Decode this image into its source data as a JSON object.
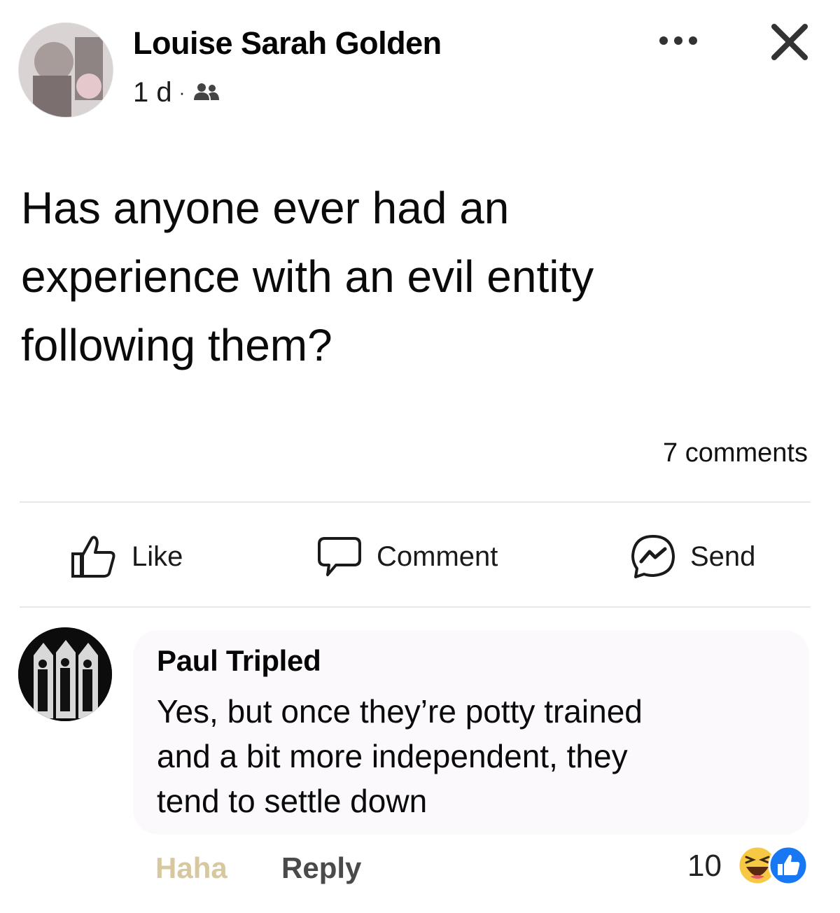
{
  "post": {
    "author": "Louise Sarah Golden",
    "time": "1 d",
    "separator": "·",
    "audience_icon": "friends-icon",
    "text_lines": [
      "Has anyone ever had an",
      "experience with an evil entity",
      "following them?"
    ],
    "comments_count": "7 comments"
  },
  "actions": {
    "like_label": "Like",
    "comment_label": "Comment",
    "send_label": "Send"
  },
  "comment": {
    "author": "Paul Tripled",
    "text_lines": [
      "Yes, but once they’re potty trained",
      "and a bit more independent, they",
      "tend to settle down"
    ],
    "haha_label": "Haha",
    "reply_label": "Reply",
    "reaction_count": "10"
  },
  "colors": {
    "text": "#050505",
    "divider": "#e6e8ec",
    "haha_highlight": "#d8c8a0",
    "like_blue": "#1877f2",
    "haha_yellow": "#f7c843"
  }
}
